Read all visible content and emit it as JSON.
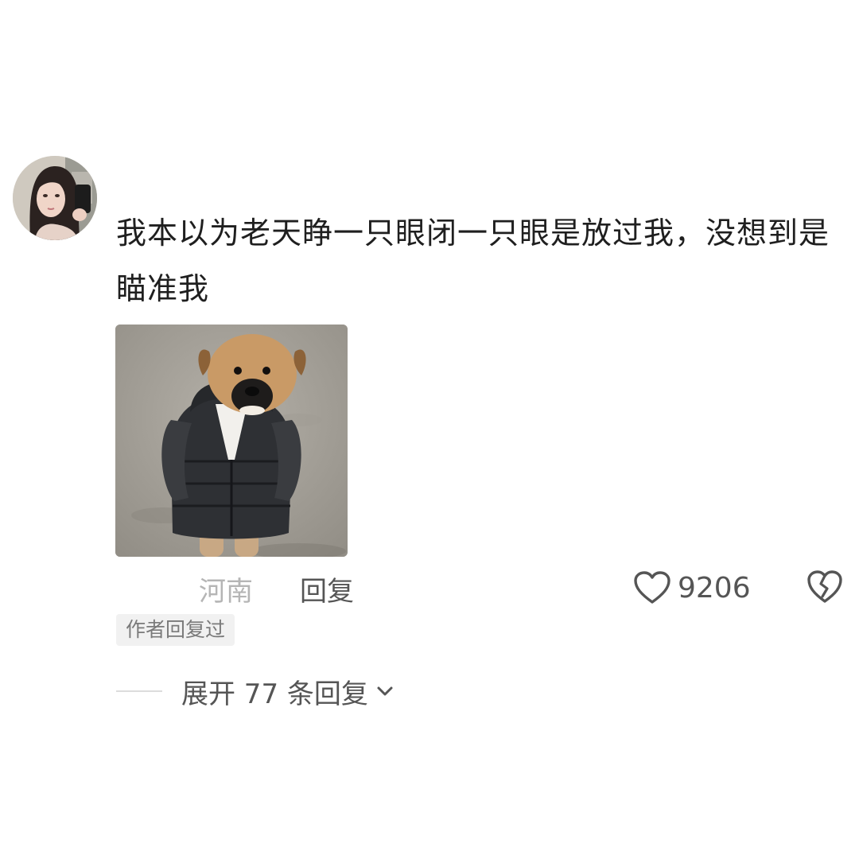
{
  "comment": {
    "text": "我本以为老天睁一只眼闭一只眼是放过我，没想到是瞄准我",
    "image_icon": "puppy-in-black-puffer-jacket-photo"
  },
  "meta": {
    "location": "河南",
    "reply_label": "回复",
    "like_count": "9206",
    "like_icon": "heart-outline-icon",
    "dislike_icon": "broken-heart-icon"
  },
  "badge": {
    "label": "作者回复过"
  },
  "replies": {
    "expand_label": "展开 77 条回复",
    "expand_icon": "chevron-down-icon"
  },
  "colors": {
    "text_primary": "#1f1f1f",
    "text_secondary": "#555555",
    "text_muted": "#b5b5b5",
    "badge_bg": "#f1f1f1"
  }
}
